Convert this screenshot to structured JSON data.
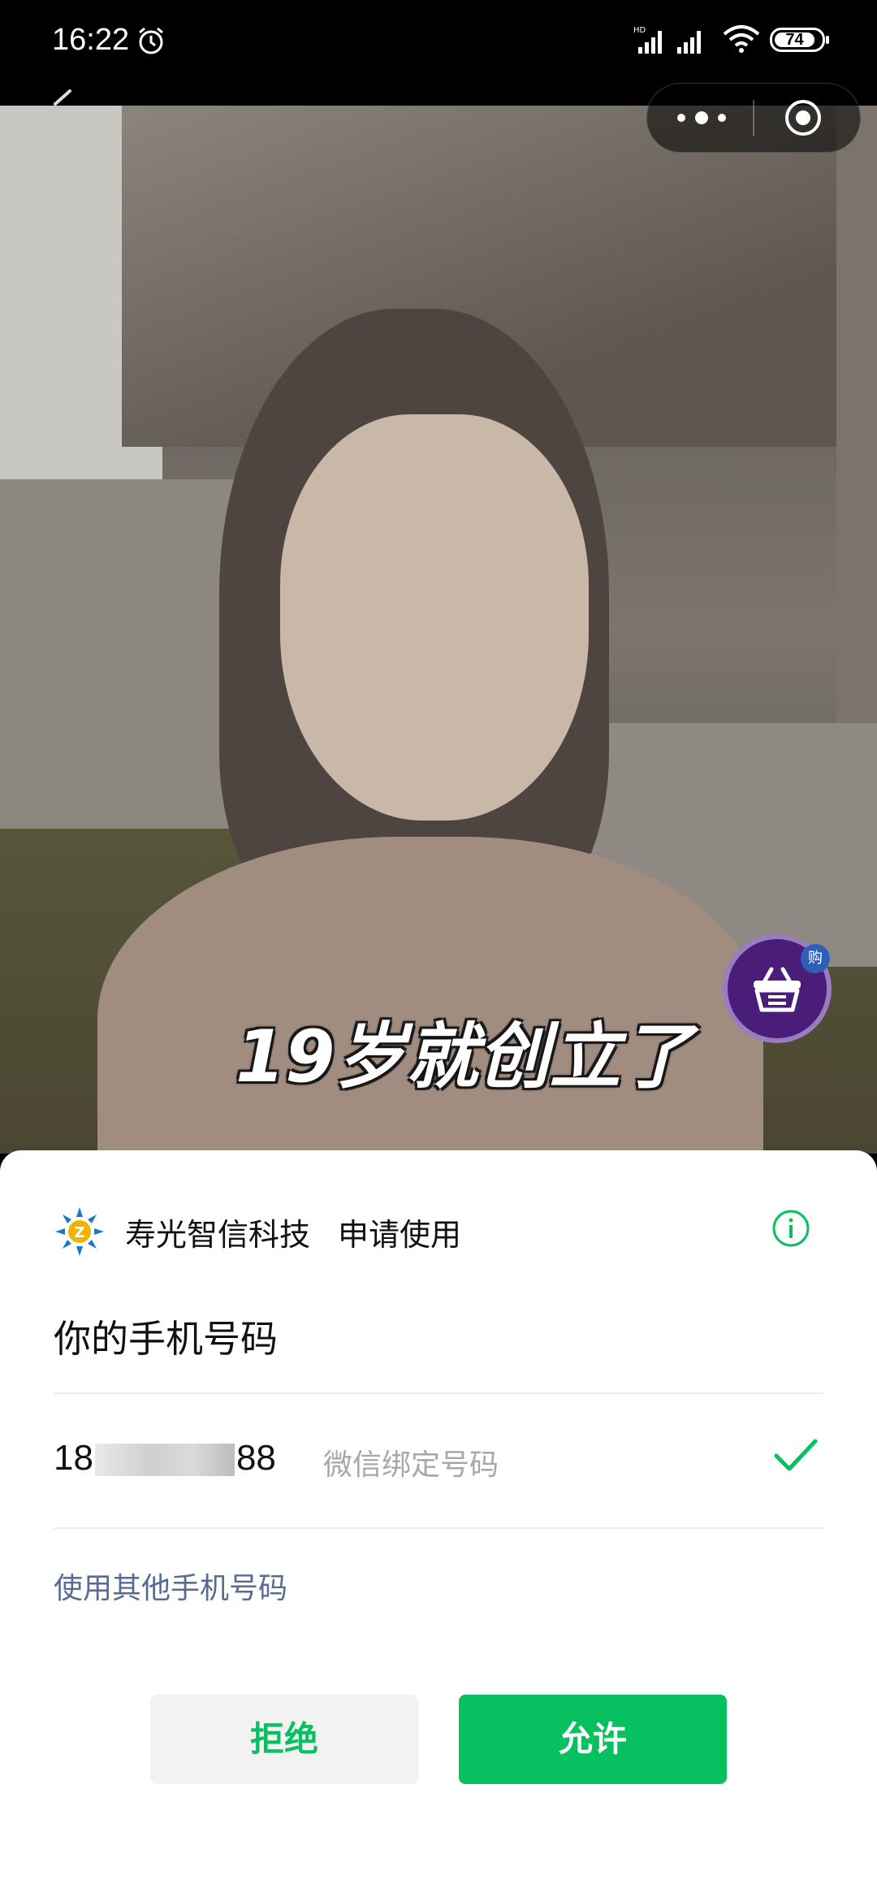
{
  "status_bar": {
    "time": "16:22",
    "battery": "74",
    "icons": [
      "alarm-icon",
      "signal-hd-icon",
      "signal-icon",
      "wifi-icon",
      "battery-icon"
    ]
  },
  "top_nav": {
    "icons": [
      "back-arrow-icon",
      "more-dots-icon",
      "close-miniprogram-icon"
    ]
  },
  "video": {
    "caption": "19岁就创立了",
    "shop_badge": "购"
  },
  "auth_sheet": {
    "app_name": "寿光智信科技",
    "request_text": "申请使用",
    "title": "你的手机号码",
    "phone_prefix": "18",
    "phone_suffix": "88",
    "phone_note": "微信绑定号码",
    "other_phone_link": "使用其他手机号码",
    "deny_label": "拒绝",
    "allow_label": "允许"
  },
  "colors": {
    "accent_green": "#07c160",
    "link_blue": "#576b95"
  }
}
